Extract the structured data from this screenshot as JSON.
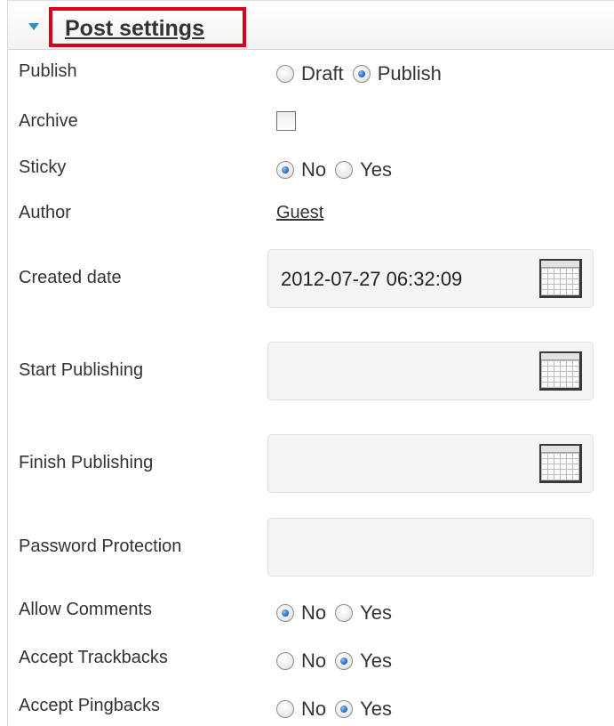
{
  "section": {
    "title": "Post settings"
  },
  "fields": {
    "publish": {
      "label": "Publish",
      "options": [
        "Draft",
        "Publish"
      ],
      "selected": "Publish"
    },
    "archive": {
      "label": "Archive",
      "checked": false
    },
    "sticky": {
      "label": "Sticky",
      "options": [
        "No",
        "Yes"
      ],
      "selected": "No"
    },
    "author": {
      "label": "Author",
      "value": "Guest"
    },
    "created_date": {
      "label": "Created date",
      "value": "2012-07-27 06:32:09"
    },
    "start_publishing": {
      "label": "Start Publishing",
      "value": ""
    },
    "finish_publishing": {
      "label": "Finish Publishing",
      "value": ""
    },
    "password_protection": {
      "label": "Password Protection",
      "value": ""
    },
    "allow_comments": {
      "label": "Allow Comments",
      "options": [
        "No",
        "Yes"
      ],
      "selected": "No"
    },
    "accept_trackbacks": {
      "label": "Accept Trackbacks",
      "options": [
        "No",
        "Yes"
      ],
      "selected": "Yes"
    },
    "accept_pingbacks": {
      "label": "Accept Pingbacks",
      "options": [
        "No",
        "Yes"
      ],
      "selected": "Yes"
    }
  },
  "icons": {
    "toggle": "triangle-down-icon",
    "date_picker": "calendar-icon"
  },
  "colors": {
    "highlight_border": "#d6001c",
    "toggle_arrow": "#2c8fc9",
    "radio_checked": "#1b5fb8"
  }
}
